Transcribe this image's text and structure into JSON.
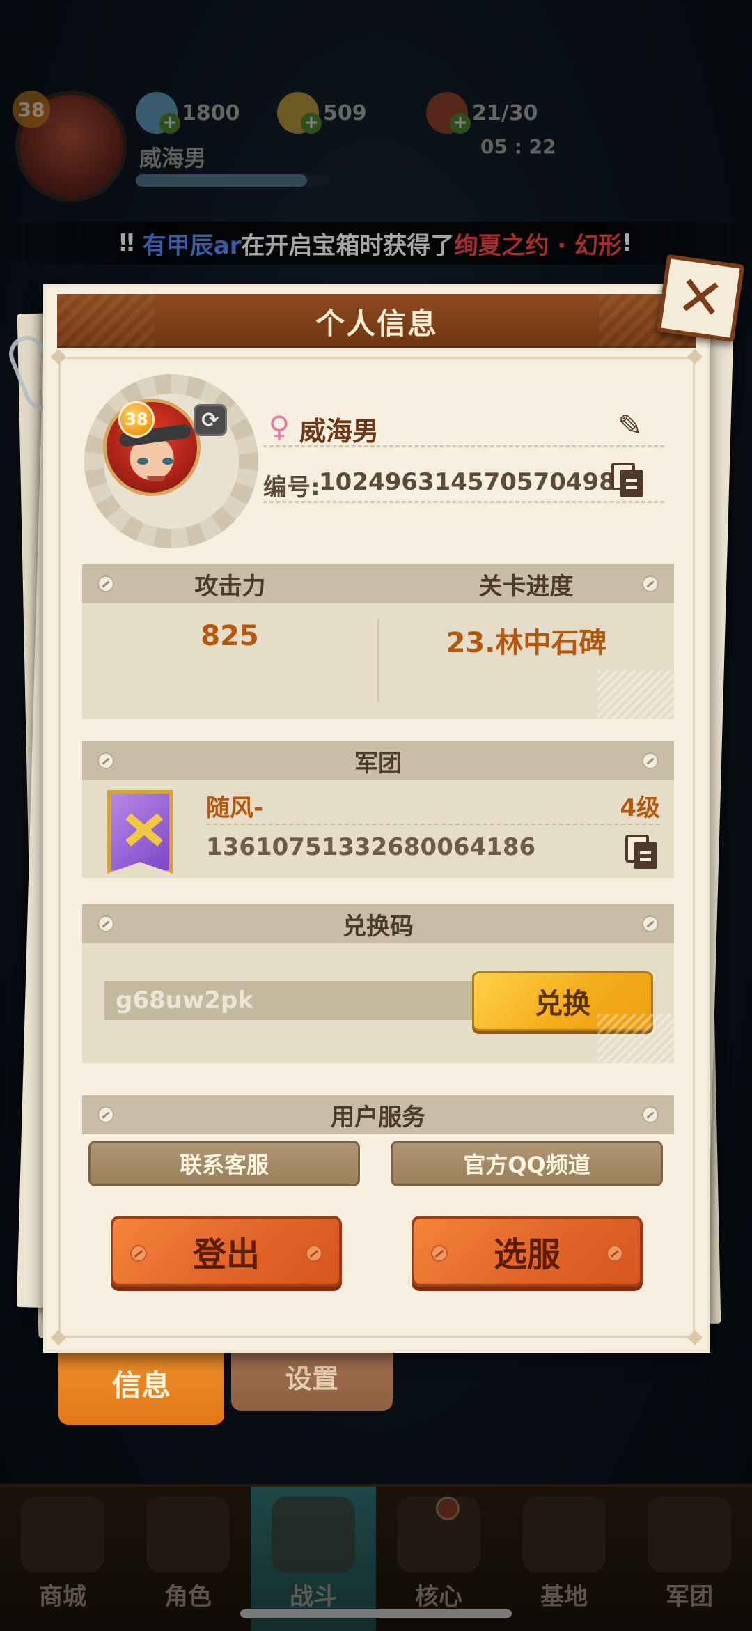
{
  "hud": {
    "level": "38",
    "player_name": "威海男",
    "gems": "1800",
    "coins": "509",
    "stamina": "21/30",
    "stamina_timer": "05 : 22",
    "exp_progress": 0.88
  },
  "ticker": {
    "prefix": "‼",
    "player": "有甲辰ar",
    "middle": "在开启宝箱时获得了",
    "item": "绚夏之约 · 幻形",
    "suffix": "!"
  },
  "panel": {
    "title": "个人信息",
    "profile": {
      "level": "38",
      "name": "威海男",
      "id_label": "编号:",
      "id_value": "1024963145705704984"
    },
    "stats": {
      "attack_label": "攻击力",
      "attack_value": "825",
      "stage_label": "关卡进度",
      "stage_value": "23.林中石碑"
    },
    "legion": {
      "header": "军团",
      "name": "随风-",
      "level": "4级",
      "id": "1361075133268006418​6"
    },
    "redeem": {
      "header": "兑换码",
      "code": "g68uw2pk",
      "button": "兑换"
    },
    "service": {
      "header": "用户服务",
      "contact": "联系客服",
      "qq_channel": "官方QQ频道"
    },
    "logout": "登出",
    "select_server": "选服"
  },
  "tabs": {
    "info": "信息",
    "settings": "设置"
  },
  "nav": [
    {
      "label": "商城",
      "icon": "shop-icon"
    },
    {
      "label": "角色",
      "icon": "character-icon"
    },
    {
      "label": "战斗",
      "icon": "battle-icon"
    },
    {
      "label": "核心",
      "icon": "core-icon"
    },
    {
      "label": "基地",
      "icon": "base-icon"
    },
    {
      "label": "军团",
      "icon": "legion-icon"
    }
  ],
  "colors": {
    "panel_bg": "#f6efdf",
    "title_bar": "#7a3d18",
    "accent_orange": "#e2652a",
    "accent_yellow": "#f4ad1b",
    "value_text": "#b4580f",
    "ticker_player": "#5b8dff",
    "ticker_item": "#ff4646"
  }
}
